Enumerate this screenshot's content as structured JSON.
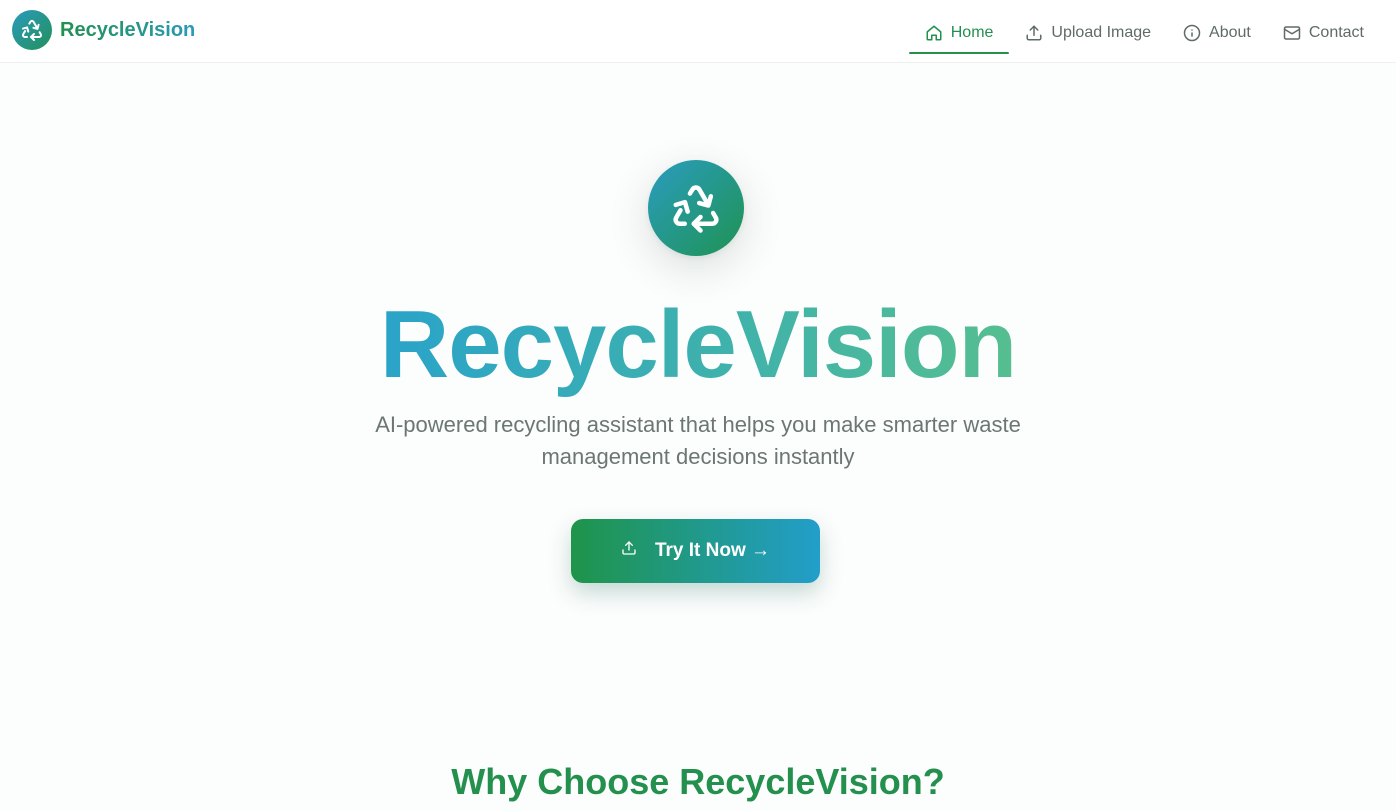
{
  "brand": {
    "name": "RecycleVision",
    "icon": "recycle-icon"
  },
  "nav": {
    "items": [
      {
        "label": "Home",
        "icon": "home-icon",
        "active": true
      },
      {
        "label": "Upload Image",
        "icon": "upload-icon",
        "active": false
      },
      {
        "label": "About",
        "icon": "info-icon",
        "active": false
      },
      {
        "label": "Contact",
        "icon": "mail-icon",
        "active": false
      }
    ]
  },
  "hero": {
    "icon": "recycle-icon",
    "title": "RecycleVision",
    "subtitle": "AI-powered recycling assistant that helps you make smarter waste management decisions instantly",
    "cta_label": "Try It Now →",
    "cta_icon": "upload-icon"
  },
  "features": {
    "title": "Why Choose RecycleVision?"
  },
  "colors": {
    "primary_green": "#23904e",
    "accent_blue": "#229eca",
    "text_muted": "#6c7773"
  }
}
